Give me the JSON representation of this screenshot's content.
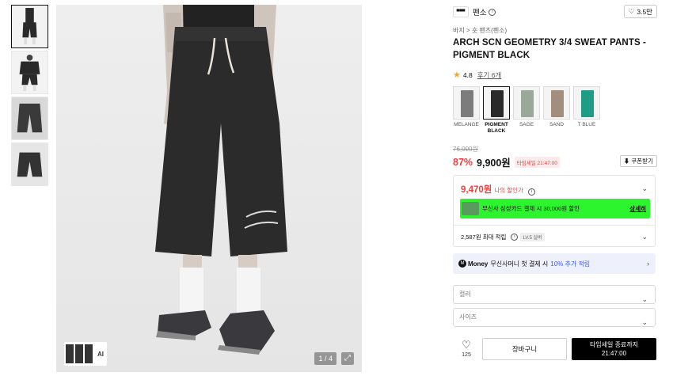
{
  "brand": {
    "logo_text": "▀▀▀",
    "name": "펜소",
    "info_icon": "info-icon"
  },
  "likes": {
    "icon": "heart-outline-icon",
    "count": "3.5만"
  },
  "breadcrumb": "바지 > 숏 팬츠(펜소)",
  "product": {
    "title": "ARCH SCN GEOMETRY 3/4 SWEAT PANTS - PIGMENT BLACK"
  },
  "rating": {
    "score": "4.8",
    "reviews": "후기 6개"
  },
  "colors": [
    {
      "label": "MELANGE",
      "color": "#7c7c7c",
      "active": false
    },
    {
      "label": "PIGMENT BLACK",
      "color": "#2a2a2a",
      "active": true
    },
    {
      "label": "SAGE",
      "color": "#9aa89a",
      "active": false
    },
    {
      "label": "SAND",
      "color": "#a38e7e",
      "active": false
    },
    {
      "label": "T BLUE",
      "color": "#1e9c86",
      "active": false
    }
  ],
  "pricing": {
    "original": "76,000원",
    "discount": "87%",
    "price": "9,900원",
    "sale_tag": "타임세일 21:47:00",
    "coupon_label": "쿠폰받기"
  },
  "benefit": {
    "my_price": "9,470원",
    "my_price_label": "나의 할인가",
    "promo_text": "무신사 삼성카드 결제 시 30,000원 할인",
    "promo_link": "상세히",
    "points_text": "2,587원 최대 적립",
    "level": "LV.5 실버"
  },
  "money": {
    "logo": "M",
    "brand": "Money",
    "text": "무신사머니 첫 결제 시",
    "highlight": "10% 추가 적립"
  },
  "options": {
    "color_placeholder": "컬러",
    "size_placeholder": "사이즈"
  },
  "bottom": {
    "heart_count": "125",
    "cart_label": "장바구니",
    "buy_line1": "타임세일 종료까지",
    "buy_line2": "21:47:00"
  },
  "gallery": {
    "pager": "1 / 4",
    "ai_label": "AI"
  },
  "accent_colors": {
    "sale_red": "#f03c3c",
    "promo_green": "#2df52d",
    "money_blue": "#3d5afe"
  }
}
